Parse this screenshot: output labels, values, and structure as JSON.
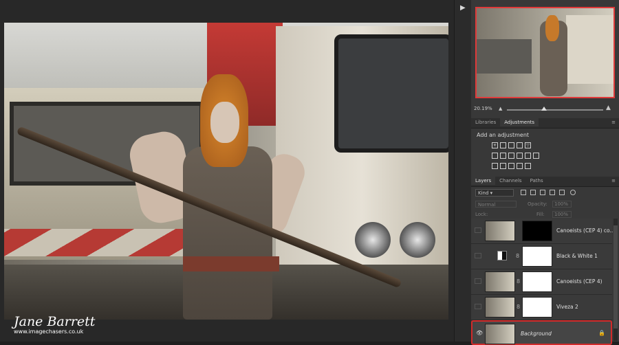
{
  "watermark": {
    "name": "Jane Barrett",
    "url": "www.imagechasers.co.uk"
  },
  "navigator": {
    "zoom": "20.19%"
  },
  "adjustments": {
    "tabs": [
      {
        "label": "Libraries"
      },
      {
        "label": "Adjustments"
      }
    ],
    "heading": "Add an adjustment"
  },
  "layers_panel": {
    "tabs": [
      {
        "label": "Layers"
      },
      {
        "label": "Channels"
      },
      {
        "label": "Paths"
      }
    ],
    "kind_label": "Kind",
    "blend_mode": "Normal",
    "opacity_label": "Opacity:",
    "opacity_value": "100%",
    "lock_label": "Lock:",
    "fill_label": "Fill:",
    "fill_value": "100%",
    "layers": [
      {
        "name": "Canoeists (CEP 4) co..."
      },
      {
        "name": "Black & White 1"
      },
      {
        "name": "Canoeists (CEP 4)"
      },
      {
        "name": "Viveza 2"
      },
      {
        "name": "Background"
      }
    ]
  },
  "colors": {
    "selection": "#d22a2a",
    "panel_bg": "#383838"
  }
}
